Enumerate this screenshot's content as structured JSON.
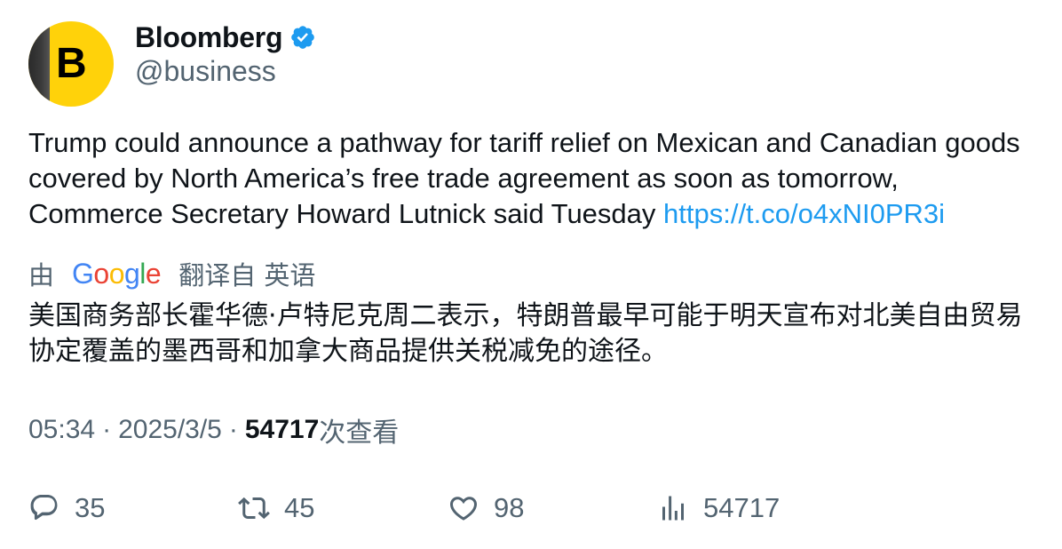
{
  "author": {
    "avatar_letter": "B",
    "display_name": "Bloomberg",
    "handle": "@business",
    "verified": true
  },
  "tweet": {
    "text": "Trump could announce a pathway for tariff relief on Mexican and Canadian goods covered by North America’s free trade agreement as soon as tomorrow, Commerce Secretary Howard Lutnick said Tuesday ",
    "link": "https://t.co/o4xNI0PR3i"
  },
  "translation": {
    "prefix": "由",
    "provider": "Google",
    "suffix": "翻译自 英语",
    "text": "美国商务部长霍华德·卢特尼克周二表示，特朗普最早可能于明天宣布对北美自由贸易协定覆盖的墨西哥和加拿大商品提供关税减免的途径。"
  },
  "meta": {
    "time": "05:34",
    "separator": "·",
    "date": "2025/3/5",
    "views_count": "54717",
    "views_label": "次查看"
  },
  "actions": {
    "replies": "35",
    "retweets": "45",
    "likes": "98",
    "views": "54717"
  },
  "colors": {
    "link": "#1d9bf0",
    "secondary_text": "#536471",
    "avatar_bg": "#ffd20a",
    "verified": "#1d9bf0"
  }
}
